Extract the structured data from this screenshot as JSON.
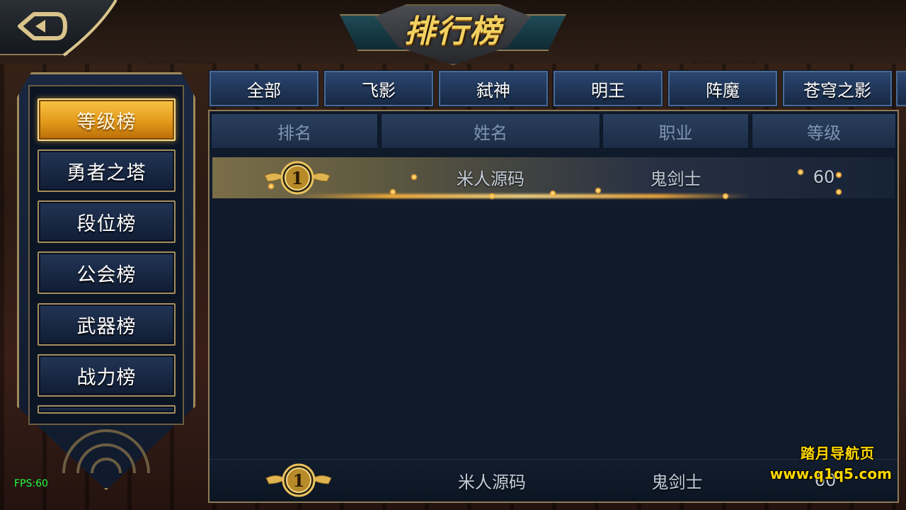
{
  "title": "排行榜",
  "categories": [
    {
      "label": "等级榜",
      "active": true
    },
    {
      "label": "勇者之塔",
      "active": false
    },
    {
      "label": "段位榜",
      "active": false
    },
    {
      "label": "公会榜",
      "active": false
    },
    {
      "label": "武器榜",
      "active": false
    },
    {
      "label": "战力榜",
      "active": false
    }
  ],
  "filter_tabs": [
    "全部",
    "飞影",
    "弑神",
    "明王",
    "阵魔",
    "苍穹之影"
  ],
  "table": {
    "headers": [
      "排名",
      "姓名",
      "职业",
      "等级"
    ],
    "rows": [
      {
        "rank": "1",
        "name": "米人源码",
        "class": "鬼剑士",
        "level": "60"
      }
    ],
    "my_row": {
      "rank": "1",
      "name": "米人源码",
      "class": "鬼剑士",
      "level": "60"
    }
  },
  "fps": "FPS:60",
  "watermark": {
    "line1": "踏月导航页",
    "line2": "www.q1q5.com"
  },
  "colors": {
    "active_tab": "#e39a1a",
    "gold_border": "#a48e5e",
    "header_text": "#7e93b3",
    "title": "#f2d160",
    "watermark": "#ffd800"
  }
}
